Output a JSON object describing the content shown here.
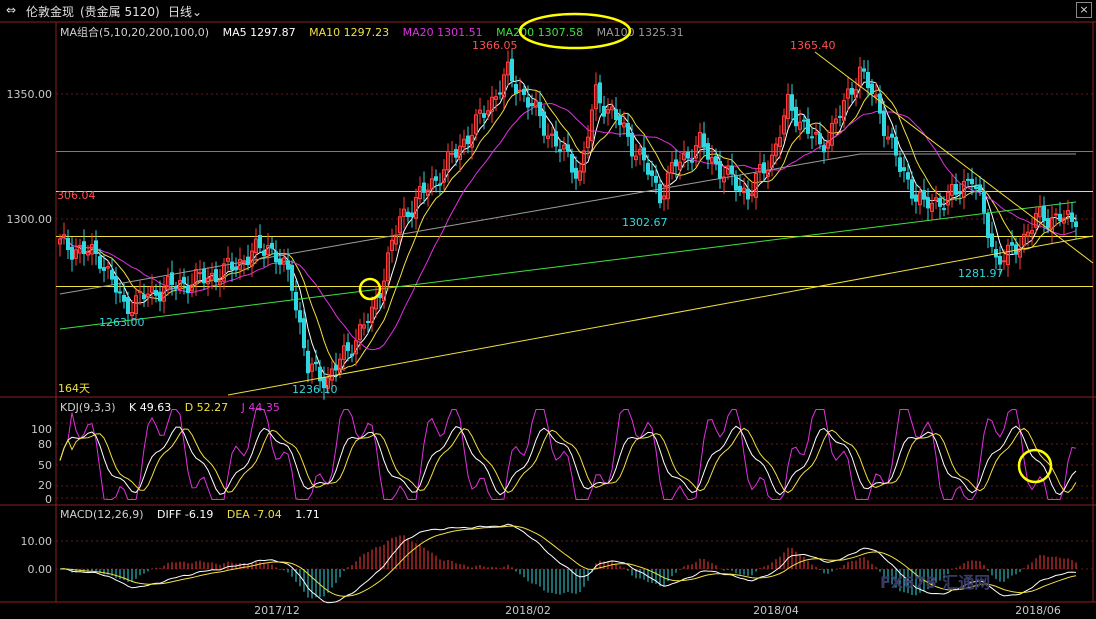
{
  "titlebar": {
    "back_icon": "double-arrow-icon",
    "symbol": "伦敦金现",
    "market": "(贵金属 5120)",
    "period": "日线",
    "close_label": "×"
  },
  "colors": {
    "up": "#ff3d3d",
    "down": "#2fd7e0",
    "ma5": "#ffffff",
    "ma10": "#f0e040",
    "ma20": "#e030e0",
    "ma200": "#3fe03f",
    "ma100": "#9a9a9a",
    "hline_yellow": "#f0e040",
    "hline_magenta": "#d040d0",
    "k": "#ffffff",
    "d": "#f0e040",
    "j": "#e030e0"
  },
  "main_legend": {
    "group": "MA组合(5,10,20,200,100,0)",
    "ma5": "MA5 1297.87",
    "ma10": "MA10 1297.23",
    "ma20": "MA20 1301.51",
    "ma200": "MA200 1307.58",
    "ma100": "MA100 1325.31"
  },
  "kdj_legend": {
    "name": "KDJ(9,3,3)",
    "k": "K 49.63",
    "d": "D 52.27",
    "j": "J 44.35"
  },
  "macd_legend": {
    "name": "MACD(12,26,9)",
    "diff": "DIFF -6.19",
    "dea": "DEA -7.04",
    "macd": "1.71"
  },
  "annotations": {
    "high1": "1366.05",
    "high2": "1365.40",
    "low_a": "1263.00",
    "low_b": "1236.10",
    "low_c": "1302.67",
    "low_d": "1281.97",
    "left_level": "306.04",
    "day_count": "164天"
  },
  "watermark": "FX678 汇通网",
  "chart_data": [
    {
      "type": "candlestick",
      "title": "伦敦金现 日线",
      "ylim": [
        1225,
        1390
      ],
      "y_ticks": [
        "1350.00",
        "1300.00"
      ],
      "x_ticks": [
        "2017/12",
        "2018/02",
        "2018/04",
        "2018/06"
      ],
      "key_points": [
        {
          "label": "1263.00",
          "value": 1263.0
        },
        {
          "label": "1236.10",
          "value": 1236.1
        },
        {
          "label": "1366.05",
          "value": 1366.05
        },
        {
          "label": "1302.67",
          "value": 1302.67
        },
        {
          "label": "1365.40",
          "value": 1365.4
        },
        {
          "label": "1281.97",
          "value": 1281.97
        }
      ],
      "horizontal_levels": [
        {
          "value": 1327,
          "color": "magenta"
        },
        {
          "value": 1311,
          "color": "yellow"
        },
        {
          "value": 1293,
          "color": "yellow"
        },
        {
          "value": 1273,
          "color": "yellow"
        }
      ],
      "trendlines": [
        {
          "from": [
            "2017/11",
            1225
          ],
          "to": [
            "2018/06",
            1293
          ]
        },
        {
          "from": [
            "2018/04",
            1365.4
          ],
          "to": [
            "2018/06",
            1283
          ]
        }
      ],
      "series": [
        {
          "name": "MA5",
          "last": 1297.87
        },
        {
          "name": "MA10",
          "last": 1297.23
        },
        {
          "name": "MA20",
          "last": 1301.51
        },
        {
          "name": "MA200",
          "last": 1307.58
        },
        {
          "name": "MA100",
          "last": 1325.31
        }
      ]
    },
    {
      "type": "line",
      "title": "KDJ(9,3,3)",
      "ylim": [
        -5,
        120
      ],
      "y_ticks": [
        "100",
        "80",
        "50",
        "20",
        "0"
      ],
      "series": [
        {
          "name": "K",
          "last": 49.63
        },
        {
          "name": "D",
          "last": 52.27
        },
        {
          "name": "J",
          "last": 44.35
        }
      ]
    },
    {
      "type": "bar",
      "title": "MACD(12,26,9)",
      "ylim": [
        -20,
        20
      ],
      "y_ticks": [
        "10.00",
        "0.00"
      ],
      "series": [
        {
          "name": "DIFF",
          "last": -6.19
        },
        {
          "name": "DEA",
          "last": -7.04
        },
        {
          "name": "MACD",
          "last": 1.71
        }
      ]
    }
  ]
}
